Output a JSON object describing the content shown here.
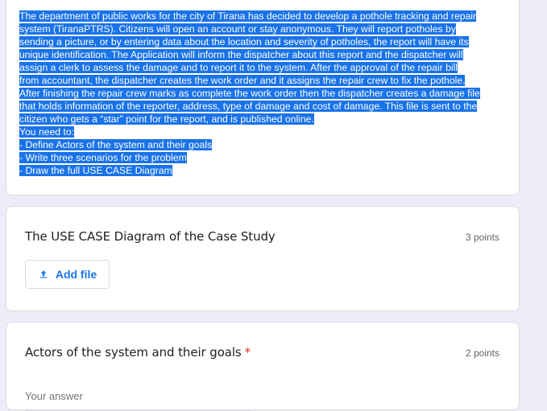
{
  "description": {
    "lines": [
      "The department of public works for the city of Tirana has decided to develop a pothole tracking and repair",
      "system (TiranaPTRS). Citizens will open an account or stay anonymous. They will report potholes by",
      "sending a picture, or by entering data about the location and severity of potholes, the report will have its",
      "unique identification. The Application will inform the dispatcher about this report and the dispatcher will",
      "assign a clerk to assess the damage and to report it to the system. After the approval of the repair bill",
      "from accountant, the dispatcher creates the work order and it assigns the repair crew to fix the pothole.",
      "After finishing the repair crew marks as complete the work order then the dispatcher creates a damage file",
      "that holds information of the reporter, address, type of damage and cost of damage. This file is sent to the",
      "citizen who gets a “star” point for the report, and is published online.",
      "You need to:",
      "- Define Actors of the system and their goals",
      "- Write three scenarios for the problem",
      "- Draw the full USE CASE Diagram"
    ],
    "selection_color": "#1a73e8"
  },
  "question_1": {
    "title": "The USE CASE Diagram of the Case Study",
    "points": "3 points",
    "add_file_label": "Add file",
    "add_file_icon": "upload-icon"
  },
  "question_2": {
    "title": "Actors of the system and their goals",
    "required_mark": "*",
    "points": "2 points",
    "answer_placeholder": "Your answer"
  },
  "colors": {
    "background": "#efebf8",
    "accent": "#1a73e8",
    "required": "#d93025"
  }
}
